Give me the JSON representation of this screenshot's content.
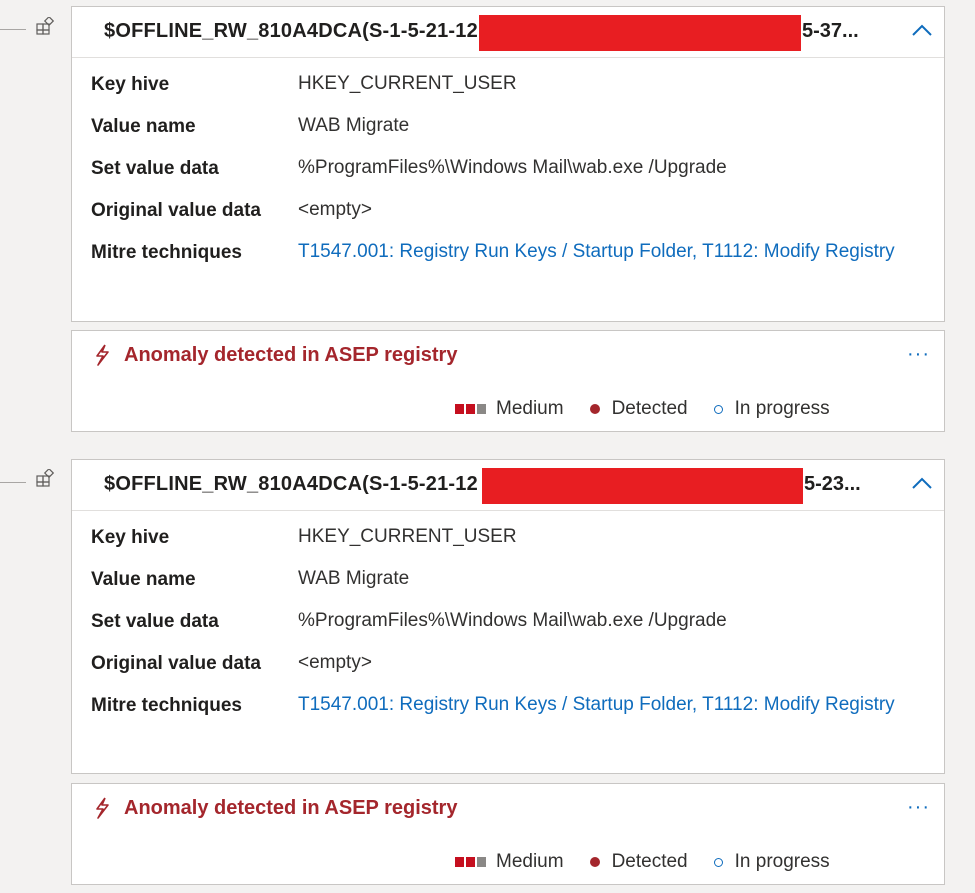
{
  "entries": [
    {
      "title_prefix": "$OFFLINE_RW_810A4DCA(S-1-5-21-12",
      "title_suffix": "5-37...",
      "props": [
        {
          "label": "Key hive",
          "value": "HKEY_CURRENT_USER"
        },
        {
          "label": "Value name",
          "value": "WAB Migrate"
        },
        {
          "label": "Set value data",
          "value": "%ProgramFiles%\\Windows Mail\\wab.exe /Upgrade"
        },
        {
          "label": "Original value data",
          "value": "<empty>"
        },
        {
          "label": "Mitre techniques",
          "value": "T1547.001: Registry Run Keys / Startup Folder, T1112: Modify Registry"
        }
      ],
      "alert": {
        "title": "Anomaly detected in ASEP registry",
        "more": "···",
        "severity": "Medium",
        "detection": "Detected",
        "status": "In progress"
      }
    },
    {
      "title_prefix": "$OFFLINE_RW_810A4DCA(S-1-5-21-12",
      "title_suffix": "5-23...",
      "props": [
        {
          "label": "Key hive",
          "value": "HKEY_CURRENT_USER"
        },
        {
          "label": "Value name",
          "value": "WAB Migrate"
        },
        {
          "label": "Set value data",
          "value": "%ProgramFiles%\\Windows Mail\\wab.exe /Upgrade"
        },
        {
          "label": "Original value data",
          "value": "<empty>"
        },
        {
          "label": "Mitre techniques",
          "value": "T1547.001: Registry Run Keys / Startup Folder, T1112: Modify Registry"
        }
      ],
      "alert": {
        "title": "Anomaly detected in ASEP registry",
        "more": "···",
        "severity": "Medium",
        "detection": "Detected",
        "status": "In progress"
      }
    }
  ],
  "colors": {
    "redaction": "#e81e22",
    "alert_title": "#a4262c",
    "link": "#0f6cbd",
    "severity_on": "#c50f1f",
    "severity_off": "#8a8886"
  },
  "severity_level": {
    "filled": 2,
    "total": 3
  },
  "icons": [
    "registry-tree-icon",
    "chevron-up-icon",
    "lightning-icon",
    "more-icon"
  ]
}
